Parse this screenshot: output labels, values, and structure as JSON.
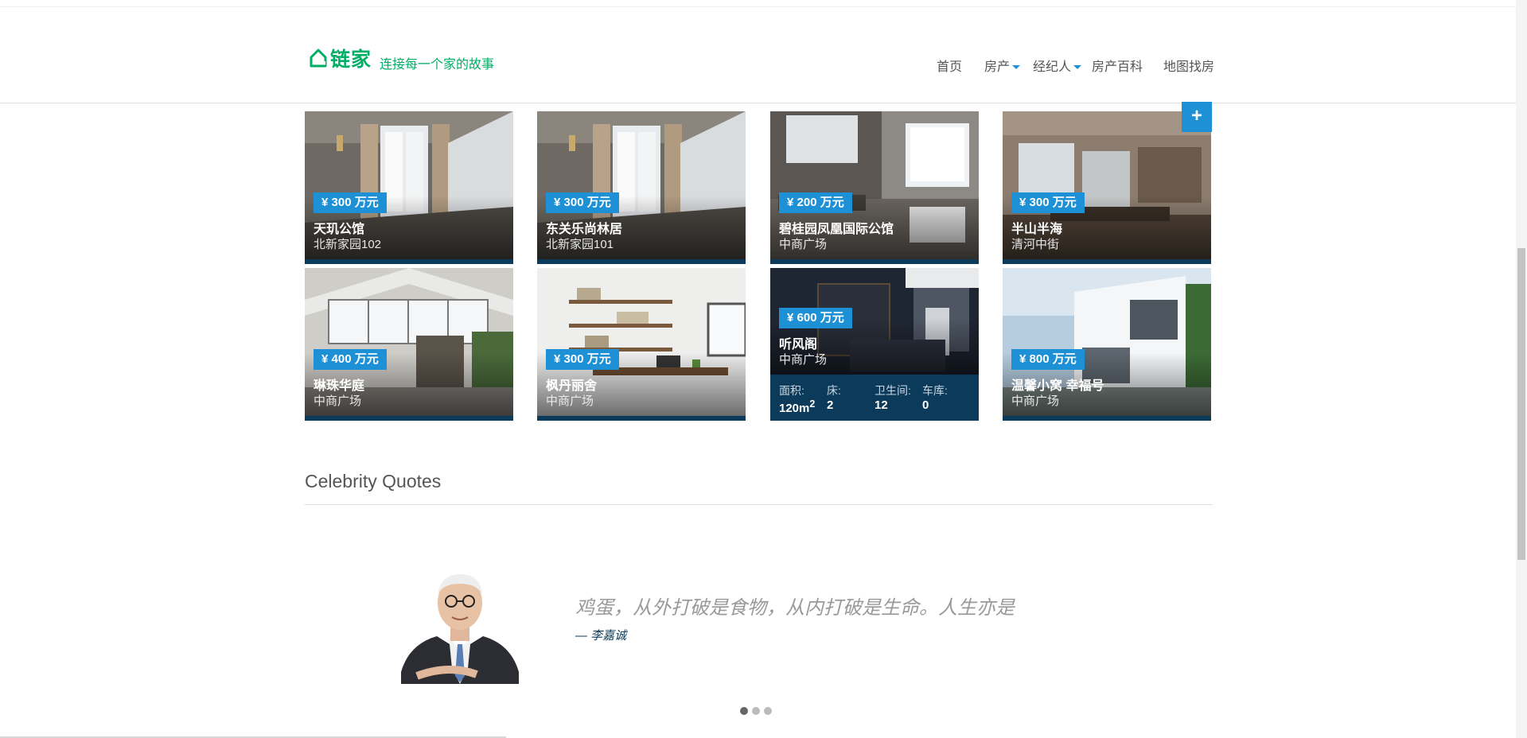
{
  "brand": {
    "logo_text": "链家",
    "slogan": "连接每一个家的故事",
    "brand_color": "#00ae66"
  },
  "nav": {
    "items": [
      {
        "label": "首页",
        "dropdown": false
      },
      {
        "label": "房产",
        "dropdown": true
      },
      {
        "label": "经纪人",
        "dropdown": true
      },
      {
        "label": "房产百科",
        "dropdown": false
      },
      {
        "label": "地图找房",
        "dropdown": false
      }
    ]
  },
  "add_button_label": "+",
  "listings": [
    {
      "price": "¥ 300 万元",
      "name": "天玑公馆",
      "address": "北新家园102",
      "scene": "bathroom-1"
    },
    {
      "price": "¥ 300 万元",
      "name": "东关乐尚林居",
      "address": "北新家园101",
      "scene": "bathroom-1"
    },
    {
      "price": "¥ 200 万元",
      "name": "碧桂园凤凰国际公馆",
      "address": "中商广场",
      "scene": "bathroom-2"
    },
    {
      "price": "¥ 300 万元",
      "name": "半山半海",
      "address": "清河中街",
      "scene": "kitchen"
    },
    {
      "price": "¥ 400 万元",
      "name": "琳珠华庭",
      "address": "中商广场",
      "scene": "loft"
    },
    {
      "price": "¥ 300 万元",
      "name": "枫丹丽舍",
      "address": "中商广场",
      "scene": "study"
    },
    {
      "price": "¥ 600 万元",
      "name": "听风阁",
      "address": "中商广场",
      "scene": "lounge",
      "details": {
        "area_label": "面积:",
        "area_value": "120m",
        "area_sup": "2",
        "bed_label": "床:",
        "bed_value": "2",
        "bath_label": "卫生间:",
        "bath_value": "12",
        "garage_label": "车库:",
        "garage_value": "0"
      }
    },
    {
      "price": "¥ 800 万元",
      "name": "温馨小窝 幸福号",
      "address": "中商广场",
      "scene": "villa"
    }
  ],
  "quotes": {
    "section_title": "Celebrity Quotes",
    "text": "鸡蛋，从外打破是食物，从内打破是生命。人生亦是",
    "author": "— 李嘉诚",
    "slide_count": 3,
    "active_slide": 1
  },
  "colors": {
    "accent": "#1e90d6",
    "dark_navy": "#0b3a5a"
  }
}
